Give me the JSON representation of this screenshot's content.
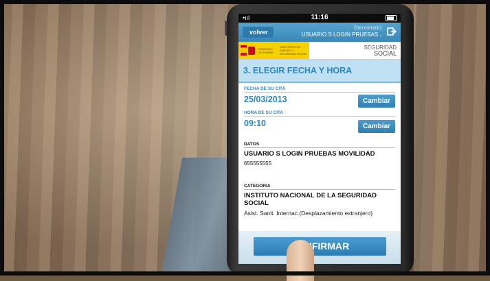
{
  "statusbar": {
    "signal": "•ııl",
    "time": "11:16"
  },
  "navbar": {
    "back_label": "volver",
    "greeting": "Bienvenido:",
    "user": "USUARIO S LOGIN PRUEBAS...",
    "logout_icon": "logout-icon"
  },
  "banner": {
    "gov_line1": "GOBIERNO DE ESPAÑA",
    "gov_line2": "MINISTERIO DE EMPLEO Y SEGURIDAD SOCIAL",
    "ss_line1": "SEGURIDAD",
    "ss_line2": "SOCIAL"
  },
  "step_title": "3. ELEGIR FECHA Y HORA",
  "fecha": {
    "label": "FECHA DE SU CITA",
    "value": "25/03/2013",
    "change_label": "Cambiar"
  },
  "hora": {
    "label": "HORA DE SU CITA",
    "value": "09:10",
    "change_label": "Cambiar"
  },
  "datos": {
    "label": "DATOS",
    "name": "USUARIO S LOGIN PRUEBAS MOVILIDAD",
    "phone": "655555555"
  },
  "categoria": {
    "label": "CATEGORIA",
    "name": "INSTITUTO NACIONAL DE LA SEGURIDAD SOCIAL",
    "detail": "Asist. Sanit. Internac.(Desplazamiento extranjero)"
  },
  "confirm_label": "CONFIRMAR",
  "colors": {
    "accent": "#2e86c1",
    "nav": "#3a88b8",
    "title_bg": "#bfe1f3",
    "gov_yellow": "#f6d100"
  }
}
